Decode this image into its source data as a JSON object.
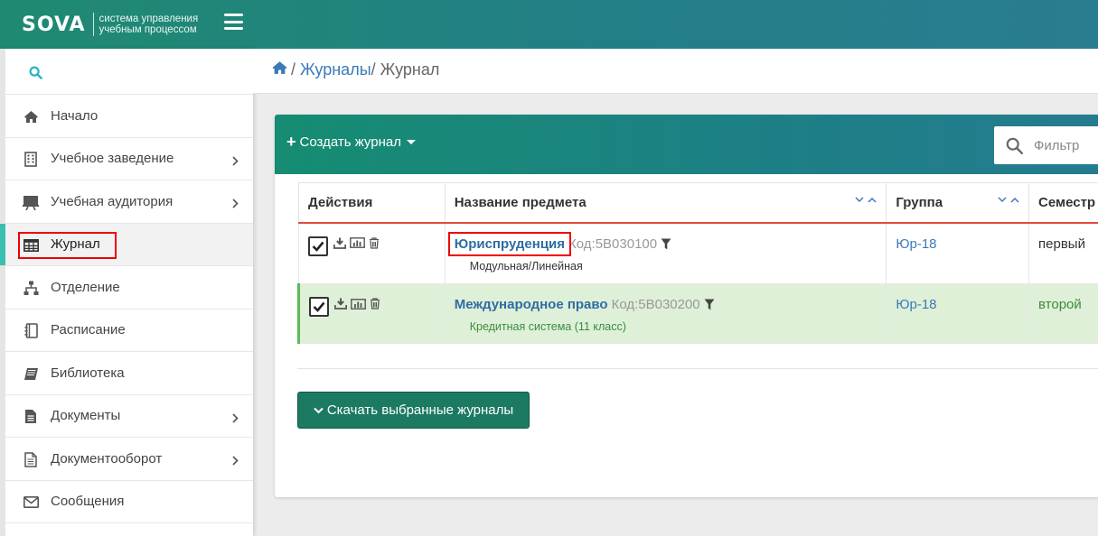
{
  "header": {
    "logo_word": "SOVA",
    "logo_tagline_1": "система управления",
    "logo_tagline_2": "учебным процессом"
  },
  "sidebar": {
    "items": [
      {
        "label": "Начало",
        "icon": "home-icon",
        "has_children": false
      },
      {
        "label": "Учебное заведение",
        "icon": "building-icon",
        "has_children": true
      },
      {
        "label": "Учебная аудитория",
        "icon": "presentation-icon",
        "has_children": true
      },
      {
        "label": "Журнал",
        "icon": "table-icon",
        "has_children": false,
        "active": true
      },
      {
        "label": "Отделение",
        "icon": "sitemap-icon",
        "has_children": false
      },
      {
        "label": "Расписание",
        "icon": "notebook-icon",
        "has_children": false
      },
      {
        "label": "Библиотека",
        "icon": "book-icon",
        "has_children": false
      },
      {
        "label": "Документы",
        "icon": "file-text-icon",
        "has_children": true
      },
      {
        "label": "Документооборот",
        "icon": "file-outline-icon",
        "has_children": true
      },
      {
        "label": "Сообщения",
        "icon": "envelope-icon",
        "has_children": false
      }
    ]
  },
  "breadcrumb": {
    "level1": "Журналы",
    "level2": "Журнал"
  },
  "toolbar": {
    "create_label": "Создать журнал",
    "filter_placeholder": "Фильтр"
  },
  "table": {
    "columns": [
      "Действия",
      "Название предмета",
      "Группа",
      "Семестр"
    ],
    "rows": [
      {
        "subject": "Юриспруденция",
        "code": "Код:5В030100",
        "system": "Модульная/Линейная",
        "group": "Юр-18",
        "semester": "первый",
        "checked": true
      },
      {
        "subject": "Международное право",
        "code": "Код:5В030200",
        "system": "Кредитная система (11 класс)",
        "group": "Юр-18",
        "semester": "второй",
        "checked": true
      }
    ]
  },
  "download_label": "Скачать выбранные журналы",
  "colors": {
    "brand": "#1f8a71",
    "highlight_row": "#dff0d8",
    "link": "#2e6da4",
    "annotation_box": "#ee0000"
  }
}
